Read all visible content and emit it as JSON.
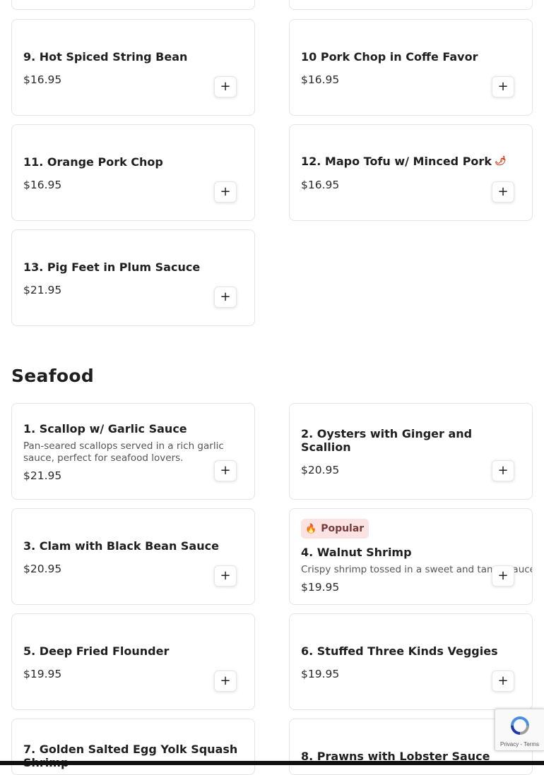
{
  "categories": {
    "seafood_title": "Seafood"
  },
  "add_button_label": "+",
  "popular_badge": {
    "label": "Popular",
    "icon": "flame-icon"
  },
  "menu": {
    "top_partial": [
      {
        "title": "",
        "price": ""
      },
      {
        "title": "",
        "price": ""
      }
    ],
    "pork": [
      {
        "title": "9. Hot Spiced String Bean",
        "price": "$16.95"
      },
      {
        "title": "10 Pork Chop in Coffe Favor",
        "price": "$16.95"
      },
      {
        "title": "11. Orange Pork Chop",
        "price": "$16.95"
      },
      {
        "title": "12. Mapo Tofu w/ Minced Pork",
        "price": "$16.95",
        "spicy_icon": "chili-icon"
      },
      {
        "title": "13. Pig Feet in Plum Sacuce",
        "price": "$21.95"
      }
    ],
    "seafood": [
      {
        "title": "1. Scallop w/ Garlic Sauce",
        "description": "Pan-seared scallops served in a rich garlic sauce, perfect for seafood lovers.",
        "price": "$21.95"
      },
      {
        "title": "2. Oysters with Ginger and Scallion",
        "price": "$20.95"
      },
      {
        "title": "3. Clam with Black Bean Sauce",
        "price": "$20.95"
      },
      {
        "title": "4. Walnut Shrimp",
        "description": "Crispy shrimp tossed in a sweet and tangy sauce",
        "price": "$19.95",
        "popular": true
      },
      {
        "title": "5. Deep Fried Flounder",
        "price": "$19.95"
      },
      {
        "title": "6. Stuffed Three Kinds Veggies",
        "price": "$19.95"
      },
      {
        "title": "7. Golden Salted Egg Yolk Squash Shrimp",
        "price": ""
      },
      {
        "title": "8. Prawns with Lobster Sauce",
        "price": ""
      }
    ]
  },
  "recaptcha": {
    "links": "Privacy - Terms"
  },
  "colors": {
    "card_border": "#e4e4e4",
    "badge_bg": "#fbe3e3",
    "badge_text": "#7a3b3b",
    "accent_spicy": "#d23b16"
  }
}
